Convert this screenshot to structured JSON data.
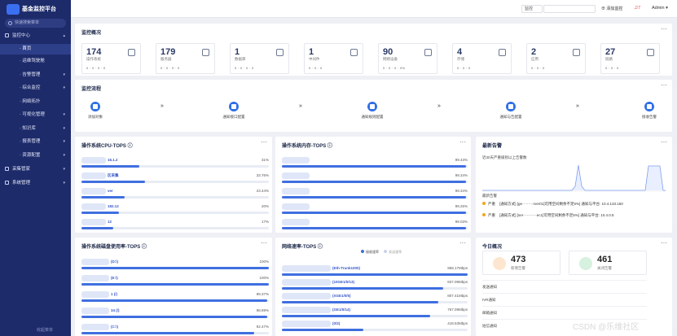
{
  "app": {
    "title": "基金监控平台",
    "search_placeholder": "快速搜索菜单"
  },
  "menu": [
    {
      "label": "监控中心",
      "level": 0,
      "caret": "▴"
    },
    {
      "label": "首页",
      "level": 1,
      "active": true
    },
    {
      "label": "运维驾驶舱",
      "level": 1
    },
    {
      "label": "告警管理",
      "level": 1,
      "caret": "▾"
    },
    {
      "label": "综合监控",
      "level": 1,
      "caret": "▾"
    },
    {
      "label": "网络拓扑",
      "level": 1
    },
    {
      "label": "可视化管理",
      "level": 1,
      "caret": "▾"
    },
    {
      "label": "知识库",
      "level": 1,
      "caret": "▾"
    },
    {
      "label": "报表管理",
      "level": 1,
      "caret": "▾"
    },
    {
      "label": "资源配置",
      "level": 1,
      "caret": "▾"
    },
    {
      "label": "采集管家",
      "level": 0,
      "caret": "▾"
    },
    {
      "label": "系统管理",
      "level": 0,
      "caret": "▾"
    }
  ],
  "sidebar_footer": "收起菜单",
  "topbar": {
    "select_value": "监控",
    "link_label": "添加监控",
    "alarm_count": "7",
    "user": "Admin"
  },
  "overview": {
    "title": "监控概况",
    "cards": [
      {
        "value": "174",
        "label": "操作系统",
        "stats": "0 · 0 · 0 · 0"
      },
      {
        "value": "179",
        "label": "服务器",
        "stats": "0 · 0 · 0 · 0"
      },
      {
        "value": "1",
        "label": "数据库",
        "stats": "0 · 0 · 0 · 0"
      },
      {
        "value": "1",
        "label": "中间件",
        "stats": "0 · 0 · 0"
      },
      {
        "value": "90",
        "label": "网络设备",
        "stats": "0 · 0 · 0 · 0%"
      },
      {
        "value": "4",
        "label": "存储",
        "stats": "0 · 0 · 0"
      },
      {
        "value": "2",
        "label": "应用",
        "stats": "0 · 0 · 0"
      },
      {
        "value": "27",
        "label": "链路",
        "stats": "0 · 0 · 0"
      }
    ]
  },
  "process": {
    "title": "监控流程",
    "steps": [
      "添加对象",
      "通知接口配置",
      "通知规则配置",
      "通知与告配置",
      "接收告警"
    ]
  },
  "cpu": {
    "title": "操作系统CPU-TOPS",
    "rows": [
      {
        "label": "16.1.2",
        "value": "31%",
        "pct": 31
      },
      {
        "label": "区采集",
        "value": "33.76%",
        "pct": 34
      },
      {
        "label": "ver",
        "value": "23.44%",
        "pct": 23
      },
      {
        "label": "182.12",
        "value": "20%",
        "pct": 20
      },
      {
        "label": "12",
        "value": "17%",
        "pct": 17
      }
    ]
  },
  "mem": {
    "title": "操作系统内存-TOPS",
    "rows": [
      {
        "label": "",
        "value": "99.43%",
        "pct": 99
      },
      {
        "label": "",
        "value": "99.34%",
        "pct": 99
      },
      {
        "label": "",
        "value": "99.34%",
        "pct": 99
      },
      {
        "label": "",
        "value": "99.25%",
        "pct": 99
      },
      {
        "label": "",
        "value": "99.03%",
        "pct": 99
      }
    ]
  },
  "alarm": {
    "title": "最新告警",
    "chart_title": "近30天严重级别以上告警数",
    "list_title": "最新告警",
    "items": [
      {
        "level": "严重",
        "text": "[通知方式] [ge·········rver01]可用空间剩余不足5%] 通知与平台: 10.4.133.150"
      },
      {
        "level": "严重",
        "text": "[通知方式] [ser···········ec1]可用空间剩余不足5%] 通知与平台: 10.4.0.5"
      }
    ]
  },
  "disk": {
    "title": "操作系统磁盘使用率-TOPS",
    "rows": [
      {
        "label": "(D:\\)",
        "value": "100%",
        "pct": 100
      },
      {
        "label": "(E:\\)",
        "value": "100%",
        "pct": 100
      },
      {
        "label": "1 (/)",
        "value": "99.37%",
        "pct": 99
      },
      {
        "label": "34 (/)",
        "value": "98.89%",
        "pct": 99
      },
      {
        "label": "(C:\\)",
        "value": "92.47%",
        "pct": 92
      }
    ]
  },
  "net": {
    "title": "网络速率-TOPS",
    "legend": [
      "接收速率",
      "发送速率"
    ],
    "rows": [
      {
        "label": "(Eth-Trunk1000)",
        "value": "958.17Mbps",
        "pct": 100
      },
      {
        "label": "(10GE1/0/13)",
        "value": "837.09Mbps",
        "pct": 87
      },
      {
        "label": "(XGE1/0/5)",
        "value": "807.41Mbps",
        "pct": 84
      },
      {
        "label": "(GE1/0/14)",
        "value": "767.09Mbps",
        "pct": 80
      },
      {
        "label": "(0/2)",
        "value": "418.53Mbps",
        "pct": 44
      }
    ]
  },
  "today": {
    "title": "今日概况",
    "new_alarms": "473",
    "new_alarms_label": "新增告警",
    "closed_alarms": "461",
    "closed_alarms_label": "关闭告警",
    "rows": [
      "发送通知",
      "IVR通知",
      "邮箱通知",
      "短信通知"
    ]
  },
  "watermark": "CSDN @乐维社区",
  "colors": {
    "sidebar": "#1d2b6b",
    "accent": "#3f6fe0",
    "alarm_dot": "#f2a51c"
  }
}
